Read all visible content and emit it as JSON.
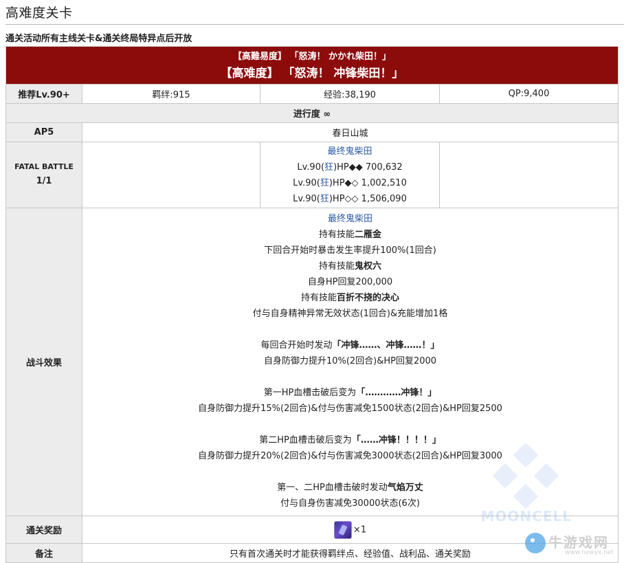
{
  "page": {
    "title": "高难度关卡",
    "subtitle": "通关活动所有主线关卡&通关终局特异点后开放"
  },
  "quest": {
    "header_jp": "【高難易度】 「怒涛！ かかれ柴田！」",
    "header_cn": "【高难度】 「怒涛！ 冲锋柴田！」",
    "recommended": "推荐Lv.90+",
    "bond": "羁绊:915",
    "exp": "经验:38,190",
    "qp": "QP:9,400",
    "progress": "进行度 ∞",
    "ap_label": "AP5",
    "location": "春日山城",
    "battle_label_1": "FATAL BATTLE",
    "battle_label_2": "1/1",
    "enemy_name": "最终鬼柴田",
    "enemy_lines": [
      {
        "pre": "Lv.90(",
        "cls": "狂",
        "post": ")HP◆◆ 700,632"
      },
      {
        "pre": "Lv.90(",
        "cls": "狂",
        "post": ")HP◆◇ 1,002,510"
      },
      {
        "pre": "Lv.90(",
        "cls": "狂",
        "post": ")HP◇◇ 1,506,090"
      }
    ],
    "effects_label": "战斗效果",
    "effects": {
      "e01": "最终鬼柴田",
      "e02_pre": "持有技能",
      "e02_bold": "二雁金",
      "e03": "下回合开始时暴击发生率提升100%(1回合)",
      "e04_pre": "持有技能",
      "e04_bold": "鬼权六",
      "e05": "自身HP回复200,000",
      "e06_pre": "持有技能",
      "e06_bold": "百折不挠的决心",
      "e07": "付与自身精神异常无效状态(1回合)&充能增加1格",
      "e08_pre": "每回合开始时发动",
      "e08_bold": "「冲锋……、冲锋……！」",
      "e09": "自身防御力提升10%(2回合)&HP回复2000",
      "e10_pre": "第一HP血槽击破后变为",
      "e10_bold": "「…………冲锋！」",
      "e11": "自身防御力提升15%(2回合)&付与伤害减免1500状态(2回合)&HP回复2500",
      "e12_pre": "第二HP血槽击破后变为",
      "e12_bold": "「……冲锋！！！！」",
      "e13": "自身防御力提升20%(2回合)&付与伤害减免3000状态(2回合)&HP回复3000",
      "e14_pre": "第一、二HP血槽击破时发动",
      "e14_bold": "气焰万丈",
      "e15": "付与自身伤害减免30000状态(6次)"
    },
    "reward_label": "通关奖励",
    "reward_count": "×1",
    "notes_label": "备注",
    "notes": "只有首次通关时才能获得羁绊点、经验值、战利品、通关奖励"
  },
  "watermark": {
    "text": "MOONCELL",
    "logo_name": "牛游戏网",
    "logo_url": "www.newyx.net"
  }
}
